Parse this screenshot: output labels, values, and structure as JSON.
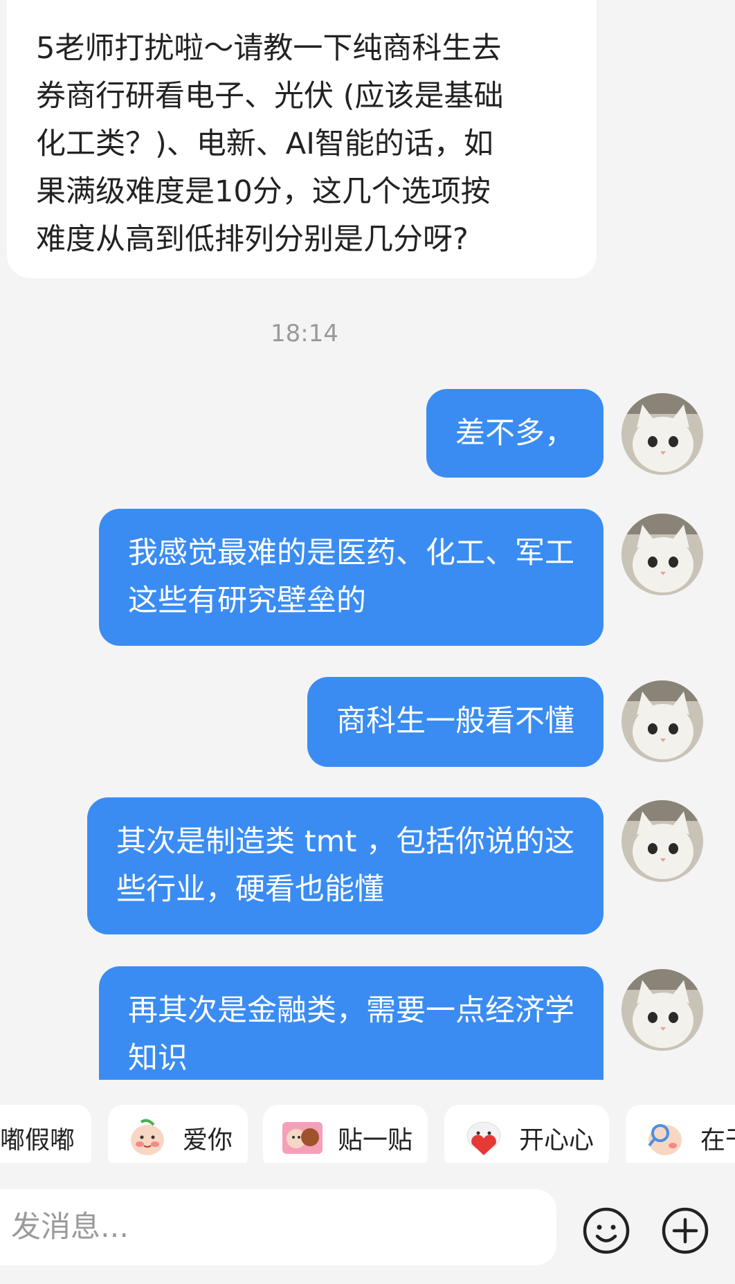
{
  "incoming_message": {
    "lines": [
      "5老师打扰啦～请教一下纯商科生去",
      "券商行研看电子、光伏 (应该是基础",
      "化工类？)、电新、AI智能的话，如",
      "果满级难度是10分，这几个选项按",
      "难度从高到低排列分别是几分呀?"
    ]
  },
  "timestamp": "18:14",
  "outgoing_messages": [
    {
      "lines": [
        "差不多，"
      ]
    },
    {
      "lines": [
        "我感觉最难的是医药、化工、军工",
        "这些有研究壁垒的"
      ]
    },
    {
      "lines": [
        "商科生一般看不懂"
      ]
    },
    {
      "lines": [
        "其次是制造类 tmt ，包括你说的这",
        "些行业，硬看也能懂"
      ]
    },
    {
      "lines": [
        "再其次是金融类，需要一点经济学",
        "知识"
      ]
    }
  ],
  "stickers": [
    {
      "label": "嘟假嘟",
      "icon": "pig-face-icon"
    },
    {
      "label": "爱你",
      "icon": "blushing-face-icon"
    },
    {
      "label": "贴一贴",
      "icon": "hugging-faces-icon"
    },
    {
      "label": "开心心",
      "icon": "heart-holding-face-icon"
    },
    {
      "label": "在干",
      "icon": "peeking-face-icon"
    }
  ],
  "composer": {
    "placeholder": "发消息..."
  },
  "colors": {
    "accent_bubble": "#3a8cf3",
    "background": "#f4f4f4"
  }
}
